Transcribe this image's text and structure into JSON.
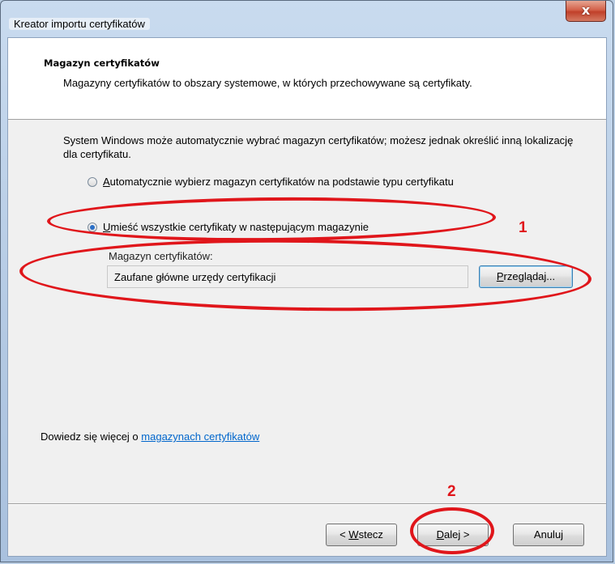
{
  "window": {
    "title": "Kreator importu certyfikatów",
    "close_glyph": "x"
  },
  "header": {
    "title": "Magazyn certyfikatów",
    "description": "Magazyny certyfikatów to obszary systemowe, w których przechowywane są certyfikaty."
  },
  "body": {
    "intro": "System Windows może automatycznie wybrać magazyn certyfikatów; możesz jednak określić inną lokalizację dla certyfikatu.",
    "option_auto": {
      "accel": "A",
      "rest": "utomatycznie wybierz magazyn certyfikatów na podstawie typu certyfikatu",
      "checked": false
    },
    "option_manual": {
      "accel": "U",
      "rest": "mieść wszystkie certyfikaty w następującym magazynie",
      "checked": true
    },
    "store_label": "Magazyn certyfikatów:",
    "store_value": "Zaufane główne urzędy certyfikacji",
    "browse": {
      "accel": "P",
      "rest": "rzeglądaj..."
    }
  },
  "learn_more": {
    "prefix": "Dowiedz się więcej o ",
    "link": "magazynach certyfikatów"
  },
  "footer": {
    "back_prefix": "< ",
    "back_accel": "W",
    "back_rest": "stecz",
    "next_accel": "D",
    "next_rest": "alej >",
    "cancel": "Anuluj"
  },
  "annotations": {
    "color": "#e0161b",
    "label1": "1",
    "label2": "2"
  }
}
